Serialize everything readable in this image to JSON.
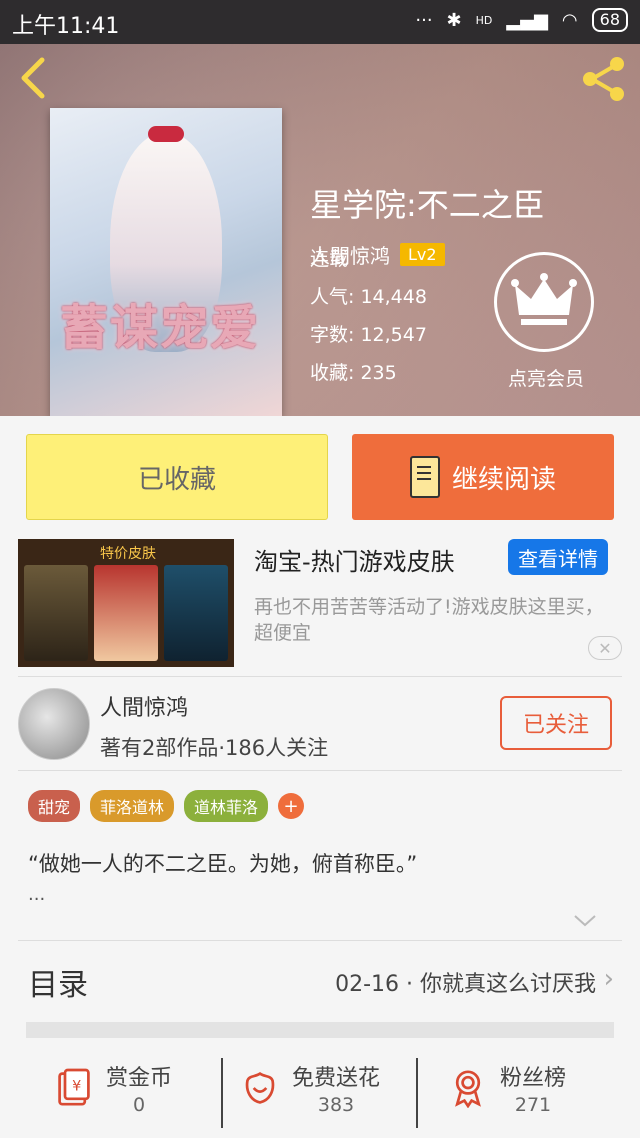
{
  "status_bar": {
    "time": "上午11:41",
    "battery": "68",
    "network": "HD"
  },
  "header": {
    "back_icon": "chevron-left-icon",
    "share_icon": "share-icon"
  },
  "book": {
    "title": "星学院:不二之臣",
    "cover_art_text": "蓄谋宠爱",
    "author": "人間惊鸿",
    "level": "Lv2",
    "status": "连载",
    "popularity": "人气: 14,448",
    "word_count": "字数: 12,547",
    "favorites": "收藏: 235",
    "vip_label": "点亮会员"
  },
  "actions": {
    "favorited": "已收藏",
    "continue_reading": "继续阅读"
  },
  "ad": {
    "banner_text": "特价皮肤",
    "title": "淘宝-热门游戏皮肤",
    "detail_button": "查看详情",
    "description": "再也不用苦苦等活动了!游戏皮肤这里买，超便宜",
    "close": "✕"
  },
  "author_info": {
    "name": "人間惊鸿",
    "meta": "著有2部作品·186人关注",
    "follow_button": "已关注"
  },
  "tags": [
    {
      "label": "甜宠",
      "color": "#c9604d"
    },
    {
      "label": "菲洛道林",
      "color": "#d99a2b"
    },
    {
      "label": "道林菲洛",
      "color": "#8cb03c"
    }
  ],
  "tag_add": "+",
  "intro": {
    "text": "“做她一人的不二之臣。为她，俯首称臣。”",
    "more": "..."
  },
  "toc": {
    "label": "目录",
    "latest": "02-16 · 你就真这么讨厌我"
  },
  "bottom": {
    "reward": {
      "label": "赏金币",
      "count": "0",
      "icon": "coin-envelope-icon"
    },
    "flower": {
      "label": "免费送花",
      "count": "383",
      "icon": "flower-icon"
    },
    "fans": {
      "label": "粉丝榜",
      "count": "271",
      "icon": "medal-icon"
    }
  }
}
